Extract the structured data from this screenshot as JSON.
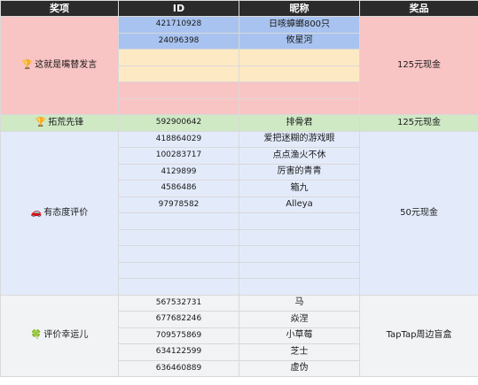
{
  "header": {
    "col_award": "奖项",
    "col_id": "ID",
    "col_nickname": "昵称",
    "col_prize": "奖品"
  },
  "groups": {
    "g1": {
      "award": "这就是嘴替发言",
      "icon": "trophy-icon",
      "prize": "125元现金",
      "rows": [
        {
          "id": "421710928",
          "nickname": "日咳蟑螂800只"
        },
        {
          "id": "24096398",
          "nickname": "攸星河"
        },
        {
          "id": "",
          "nickname": ""
        },
        {
          "id": "",
          "nickname": ""
        },
        {
          "id": "",
          "nickname": ""
        },
        {
          "id": "",
          "nickname": ""
        }
      ]
    },
    "g2": {
      "award": "拓荒先锋",
      "icon": "trophy-icon",
      "prize": "125元现金",
      "rows": [
        {
          "id": "592900642",
          "nickname": "排骨君"
        }
      ]
    },
    "g3": {
      "award": "有态度评价",
      "icon": "car-icon",
      "prize": "50元现金",
      "rows": [
        {
          "id": "418864029",
          "nickname": "爱把迷糊的游戏眼"
        },
        {
          "id": "100283717",
          "nickname": "点点渔火不休"
        },
        {
          "id": "4129899",
          "nickname": "厉害的青青"
        },
        {
          "id": "4586486",
          "nickname": "箱九"
        },
        {
          "id": "97978582",
          "nickname": "Alleya"
        },
        {
          "id": "",
          "nickname": ""
        },
        {
          "id": "",
          "nickname": ""
        },
        {
          "id": "",
          "nickname": ""
        },
        {
          "id": "",
          "nickname": ""
        },
        {
          "id": "",
          "nickname": ""
        }
      ]
    },
    "g4": {
      "award": "评价幸运儿",
      "icon": "clover-icon",
      "prize": "TapTap周边盲盒",
      "rows": [
        {
          "id": "567532731",
          "nickname": "马"
        },
        {
          "id": "677682246",
          "nickname": "焱涅"
        },
        {
          "id": "709575869",
          "nickname": "小草莓"
        },
        {
          "id": "634122599",
          "nickname": "芝士"
        },
        {
          "id": "636460889",
          "nickname": "虚伪"
        }
      ]
    }
  }
}
